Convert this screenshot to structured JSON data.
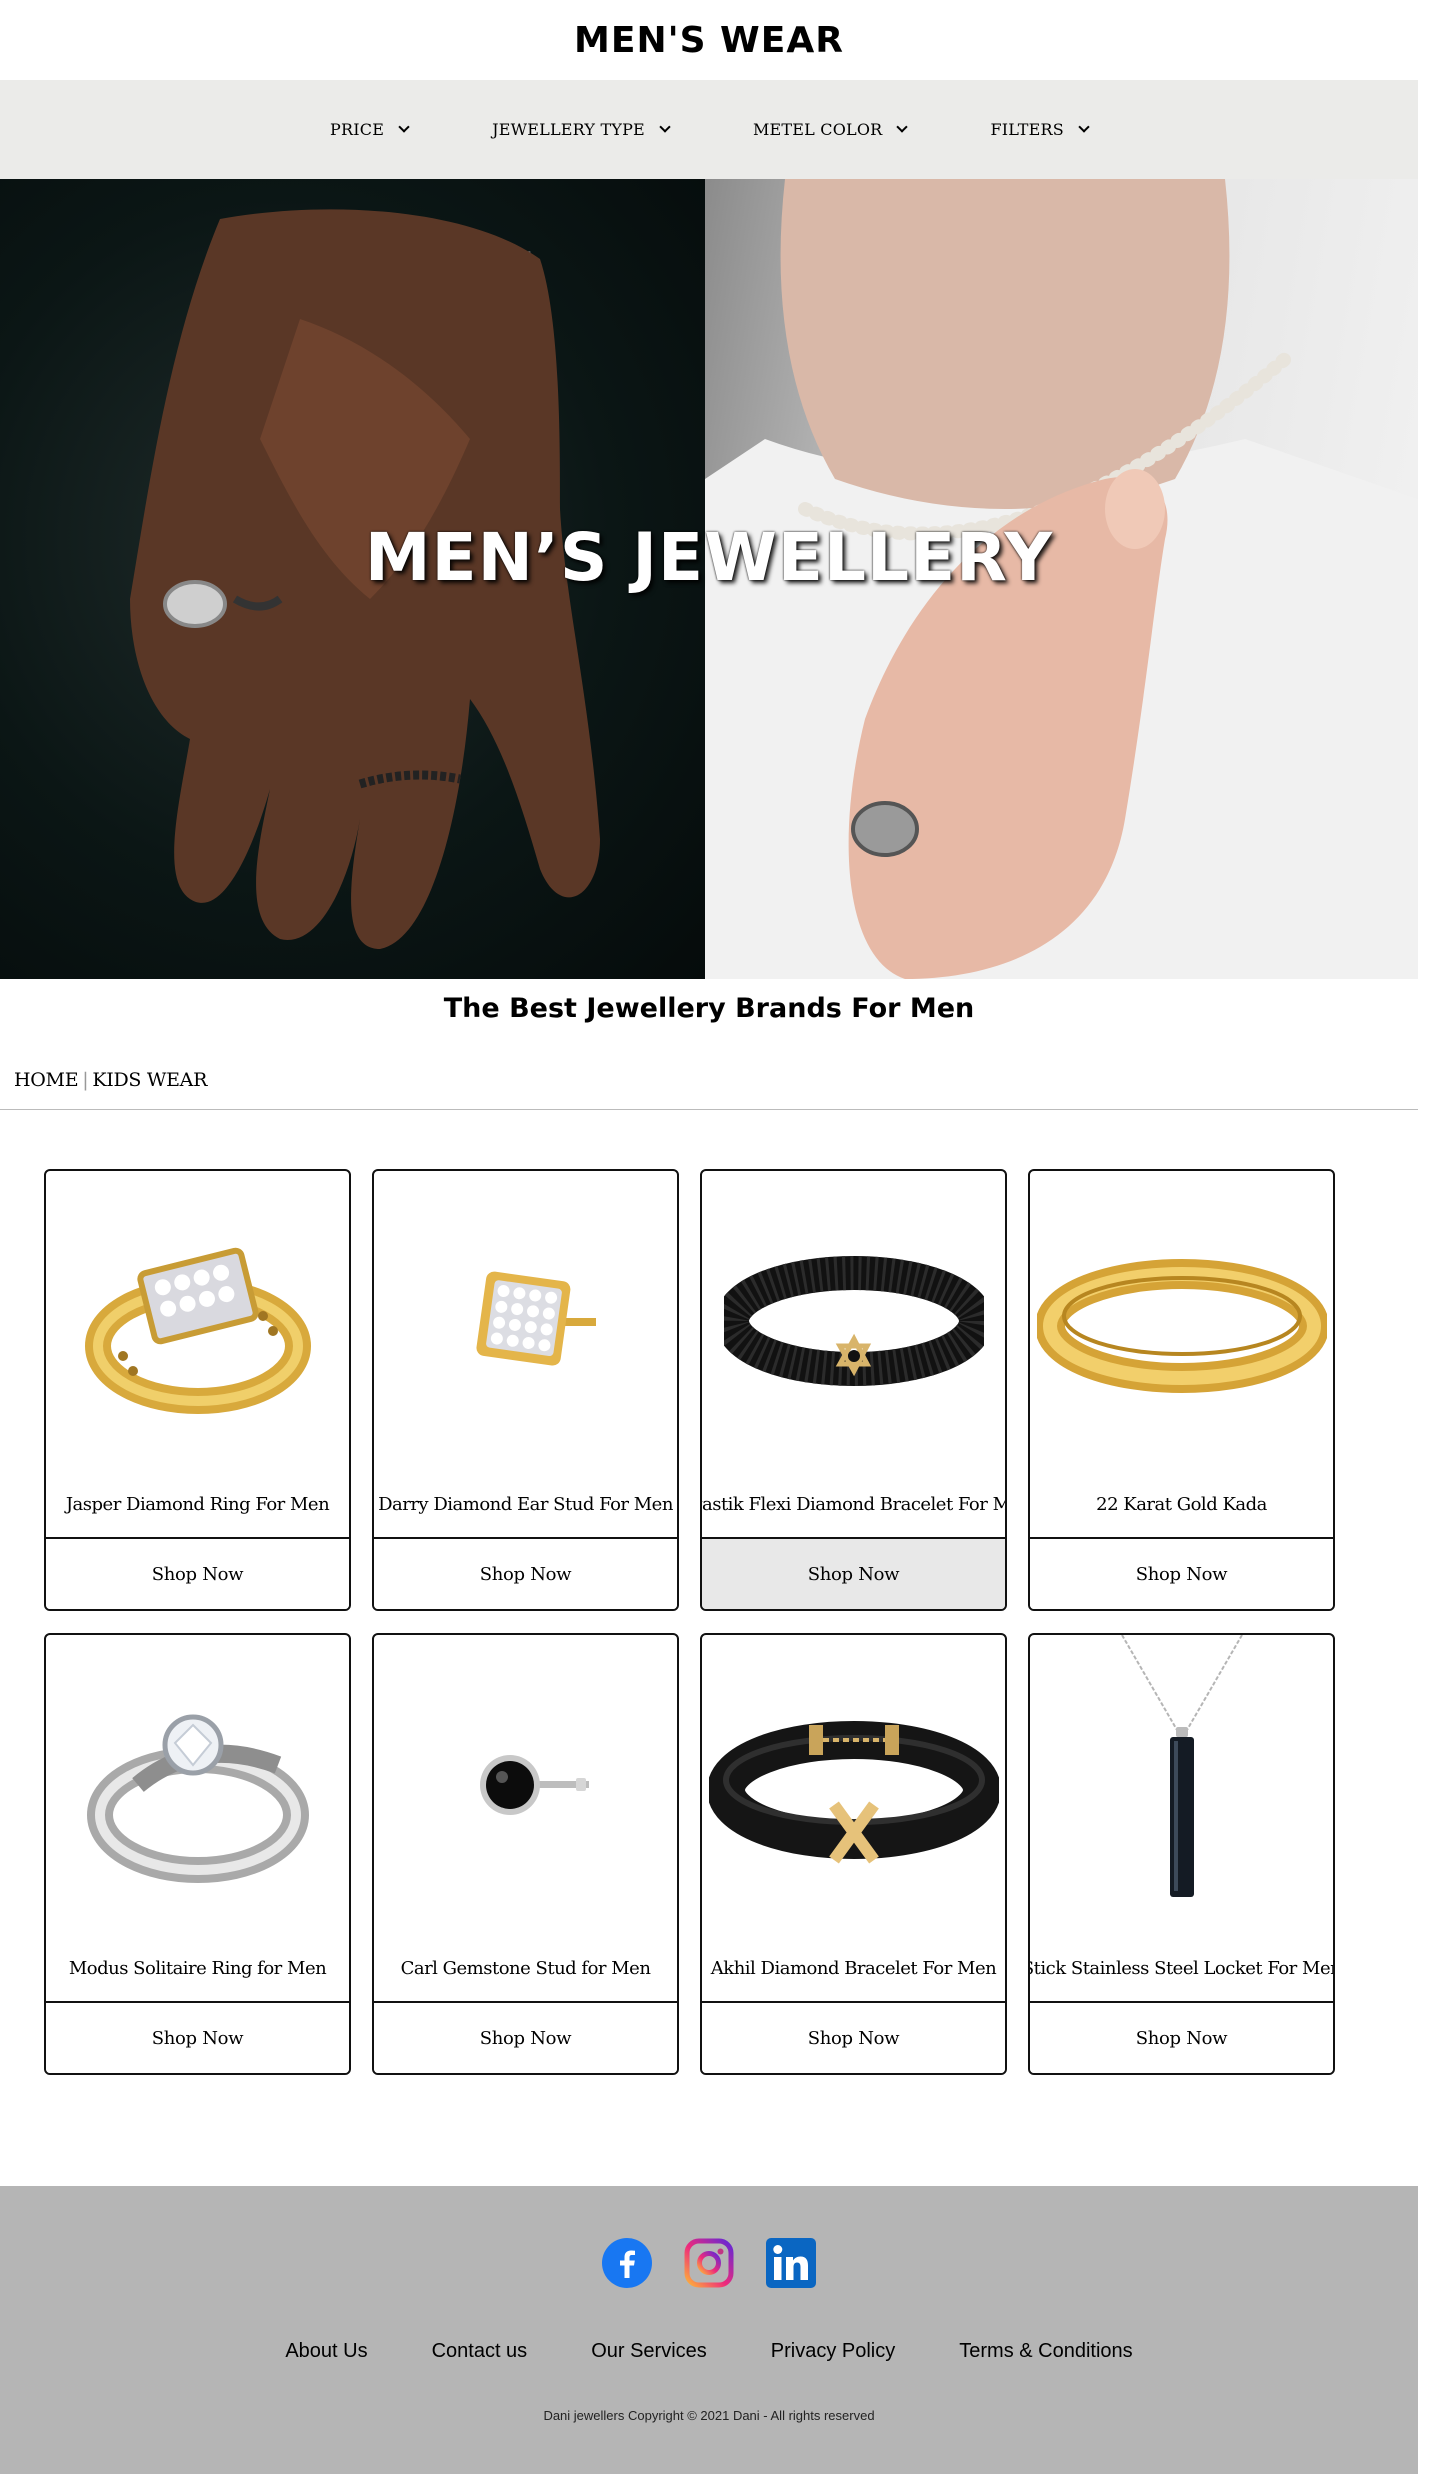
{
  "header": {
    "title": "MEN'S WEAR"
  },
  "filters": [
    {
      "label": "PRICE"
    },
    {
      "label": "JEWELLERY TYPE"
    },
    {
      "label": "METEL COLOR"
    },
    {
      "label": "FILTERS"
    }
  ],
  "hero": {
    "title": "MEN’S JEWELLERY"
  },
  "tagline": "The Best Jewellery Brands For Men",
  "breadcrumb": {
    "home": "HOME",
    "separator": "|",
    "current": "KIDS WEAR"
  },
  "products": [
    {
      "name": "Jasper Diamond Ring For Men",
      "button": "Shop Now",
      "icon": "gold-diamond-ring-icon"
    },
    {
      "name": "Darry Diamond Ear Stud For Men",
      "button": "Shop Now",
      "icon": "gold-square-stud-icon"
    },
    {
      "name": "Swastik Flexi Diamond Bracelet For Men",
      "button": "Shop Now",
      "icon": "black-star-bracelet-icon"
    },
    {
      "name": "22 Karat Gold Kada",
      "button": "Shop Now",
      "icon": "gold-kada-icon"
    },
    {
      "name": "Modus Solitaire Ring for Men",
      "button": "Shop Now",
      "icon": "silver-solitaire-ring-icon"
    },
    {
      "name": "Carl Gemstone Stud for Men",
      "button": "Shop Now",
      "icon": "black-gemstone-stud-icon"
    },
    {
      "name": "Akhil Diamond Bracelet For Men",
      "button": "Shop Now",
      "icon": "black-leather-bracelet-icon"
    },
    {
      "name": "Stick Stainless Steel Locket For Men",
      "button": "Shop Now",
      "icon": "bar-pendant-locket-icon"
    }
  ],
  "footer": {
    "socials": [
      {
        "icon": "facebook-icon",
        "color": "#1877f2"
      },
      {
        "icon": "instagram-icon",
        "color": "#d6249f"
      },
      {
        "icon": "linkedin-icon",
        "color": "#0a66c2"
      }
    ],
    "links": [
      "About Us",
      "Contact us",
      "Our Services",
      "Privacy Policy",
      "Terms & Conditions"
    ],
    "copyright": "Dani jewellers Copyright © 2021 Dani - All rights reserved"
  },
  "colors": {
    "filter_bar": "#ebebe9",
    "footer": "#b5b5b5",
    "button_hover": "#e8e8e8"
  }
}
